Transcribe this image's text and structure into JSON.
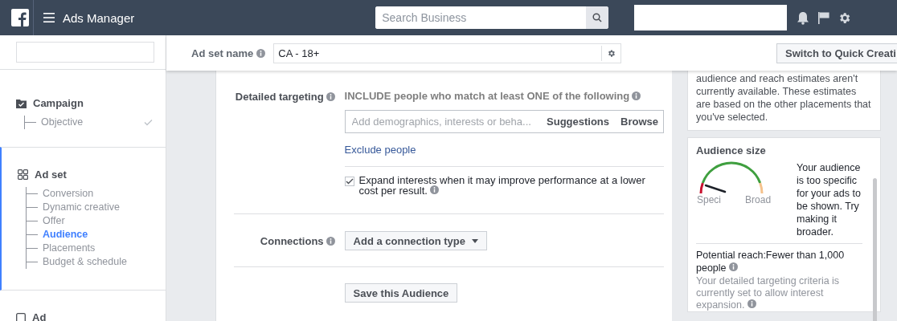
{
  "top_bar": {
    "title": "Ads Manager",
    "search": {
      "placeholder": "Search Business"
    }
  },
  "header": {
    "ad_set_name_label": "Ad set name",
    "ad_set_name_value": "CA - 18+",
    "switch_button": "Switch to Quick Creati"
  },
  "sidebar": {
    "sections": [
      {
        "title": "Campaign",
        "kind": "campaign",
        "selected": false,
        "items": [
          {
            "label": "Objective",
            "selected": false,
            "completed": true
          }
        ]
      },
      {
        "title": "Ad set",
        "kind": "adset",
        "selected": true,
        "items": [
          {
            "label": "Conversion",
            "selected": false,
            "completed": false
          },
          {
            "label": "Dynamic creative",
            "selected": false,
            "completed": false
          },
          {
            "label": "Offer",
            "selected": false,
            "completed": false
          },
          {
            "label": "Audience",
            "selected": true,
            "completed": false
          },
          {
            "label": "Placements",
            "selected": false,
            "completed": false
          },
          {
            "label": "Budget & schedule",
            "selected": false,
            "completed": false
          }
        ]
      },
      {
        "title": "Ad",
        "kind": "ad",
        "selected": false
      }
    ]
  },
  "detailed_targeting": {
    "label": "Detailed targeting",
    "include_text": "INCLUDE people who match at least ONE of the following",
    "placeholder": "Add demographics, interests or beha...",
    "suggestions": "Suggestions",
    "browse": "Browse",
    "exclude_link": "Exclude people",
    "expand": {
      "label": "Expand interests when it may improve performance at a lower cost per result.",
      "checked": true
    }
  },
  "connections": {
    "label": "Connections",
    "dropdown": "Add a connection type"
  },
  "save_button": "Save this Audience",
  "placements_note": "audience and reach estimates aren't currently available. These estimates are based on the other placements that you've selected.",
  "audience_size": {
    "title": "Audience size",
    "gauge_left": "Speci",
    "gauge_right": "Broad",
    "message": "Your audience is too specific for your ads to be shown. Try making it broader.",
    "potential_reach": "Potential reach:Fewer than 1,000 people",
    "criteria": "Your detailed targeting criteria is currently set to allow interest expansion."
  }
}
